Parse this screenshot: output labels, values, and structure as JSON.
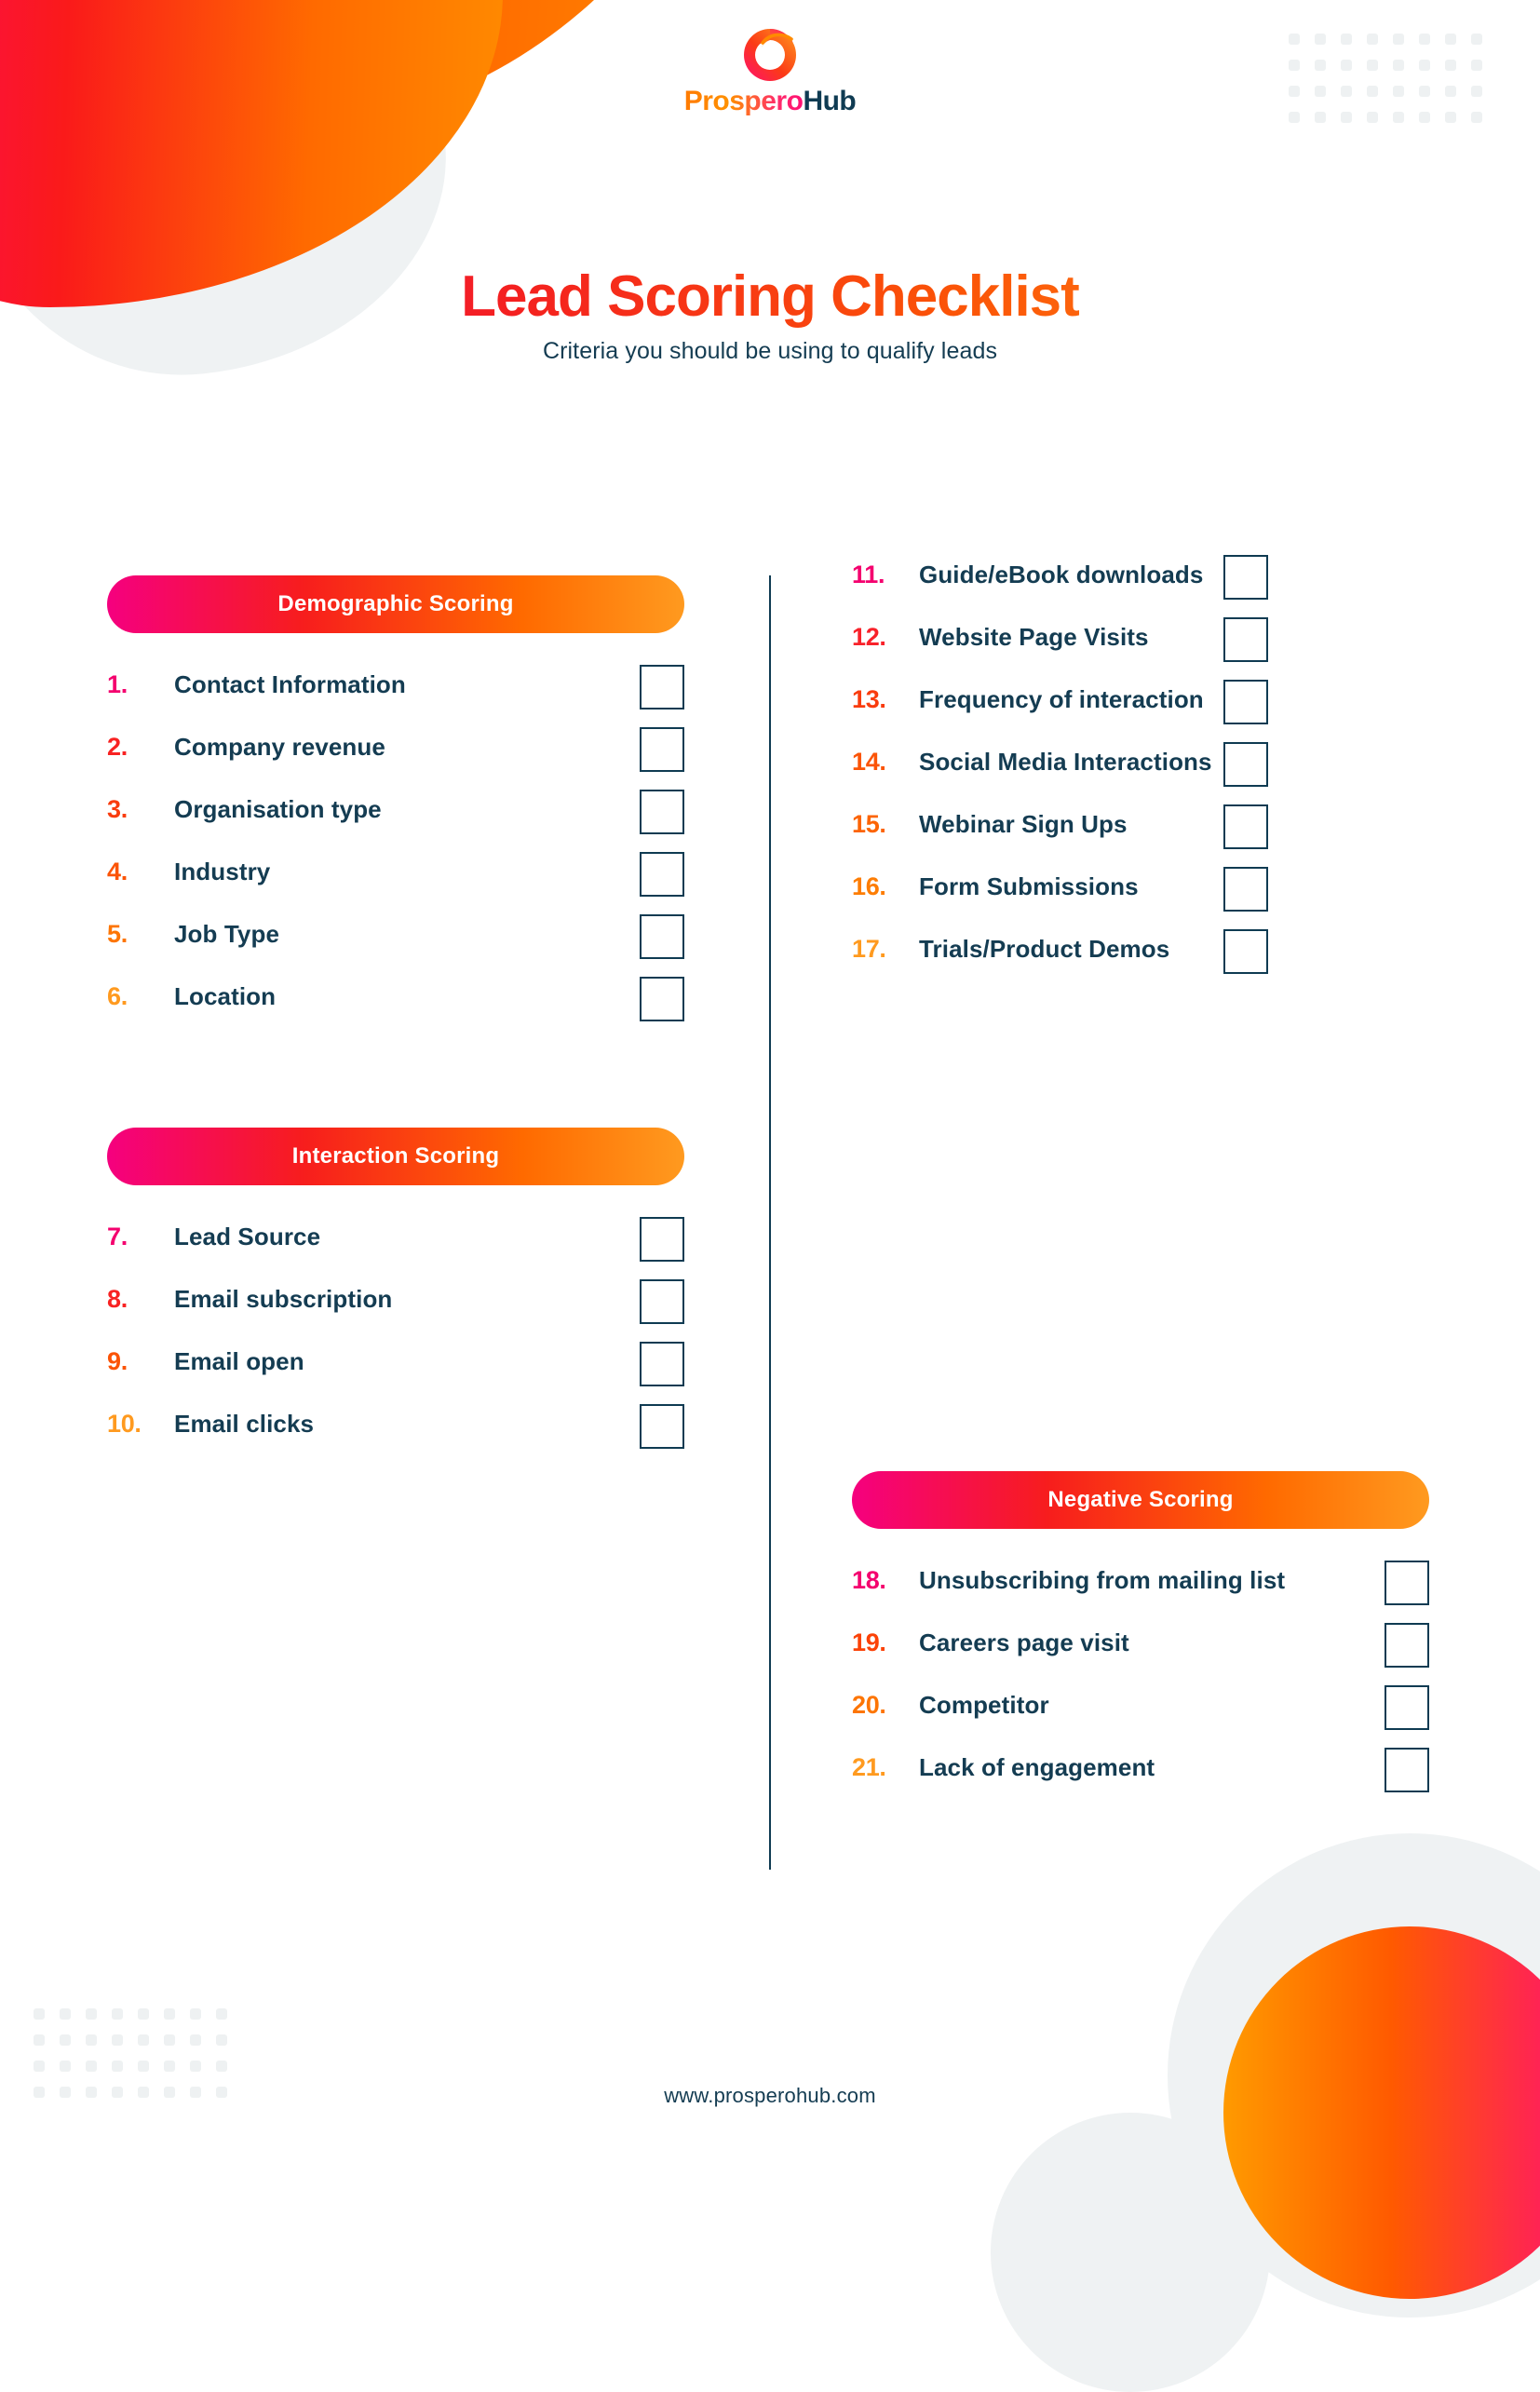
{
  "brand": {
    "logo_word_1": "Prospero",
    "logo_word_2": "Hub",
    "logo_icon": "swirl-circle-icon"
  },
  "header": {
    "title": "Lead Scoring Checklist",
    "subtitle": "Criteria you should be using to qualify leads"
  },
  "colors": {
    "pink": "#ed0f69",
    "red": "#f72020",
    "orange": "#ff6a00",
    "amber": "#ff9a1f",
    "navy": "#143c52",
    "gray_deco": "#eff2f3"
  },
  "sections": [
    {
      "id": "demographic-scoring",
      "heading": "Demographic Scoring",
      "column": "left",
      "items": [
        {
          "num": "1.",
          "label": "Contact Information",
          "color": "#f4006e",
          "checked": false
        },
        {
          "num": "2.",
          "label": "Company revenue",
          "color": "#f82222",
          "checked": false
        },
        {
          "num": "3.",
          "label": "Organisation type",
          "color": "#f93c0e",
          "checked": false
        },
        {
          "num": "4.",
          "label": "Industry",
          "color": "#fb5407",
          "checked": false
        },
        {
          "num": "5.",
          "label": "Job Type",
          "color": "#fd7504",
          "checked": false
        },
        {
          "num": "6.",
          "label": "Location",
          "color": "#ff9a1f",
          "checked": false
        }
      ]
    },
    {
      "id": "interaction-scoring",
      "heading": "Interaction Scoring",
      "column": "left",
      "items": [
        {
          "num": "7.",
          "label": "Lead Source",
          "color": "#f4006e",
          "checked": false
        },
        {
          "num": "8.",
          "label": "Email subscription",
          "color": "#f82222",
          "checked": false
        },
        {
          "num": "9.",
          "label": "Email open",
          "color": "#fb5407",
          "checked": false
        },
        {
          "num": "10.",
          "label": "Email clicks",
          "color": "#ff9a1f",
          "checked": false
        }
      ]
    },
    {
      "id": "positive-interaction-continued",
      "heading": "",
      "column": "right",
      "items": [
        {
          "num": "11.",
          "label": "Guide/eBook downloads",
          "color": "#f4006e",
          "checked": false
        },
        {
          "num": "12.",
          "label": "Website Page Visits",
          "color": "#f8222a",
          "checked": false
        },
        {
          "num": "13.",
          "label": "Frequency of interaction",
          "color": "#f93c0e",
          "checked": false
        },
        {
          "num": "14.",
          "label": "Social Media Interactions",
          "color": "#fb5407",
          "checked": false
        },
        {
          "num": "15.",
          "label": "Webinar Sign Ups",
          "color": "#fc6405",
          "checked": false
        },
        {
          "num": "16.",
          "label": "Form Submissions",
          "color": "#fd7d04",
          "checked": false
        },
        {
          "num": "17.",
          "label": "Trials/Product Demos",
          "color": "#ff9a1f",
          "checked": false
        }
      ]
    },
    {
      "id": "negative-scoring",
      "heading": "Negative Scoring",
      "column": "right",
      "items": [
        {
          "num": "18.",
          "label": "Unsubscribing from mailing list",
          "color": "#f4006e",
          "checked": false
        },
        {
          "num": "19.",
          "label": "Careers page visit",
          "color": "#fb4207",
          "checked": false
        },
        {
          "num": "20.",
          "label": "Competitor",
          "color": "#fd7504",
          "checked": false
        },
        {
          "num": "21.",
          "label": "Lack of engagement",
          "color": "#ff9a1f",
          "checked": false
        }
      ]
    }
  ],
  "footer": {
    "url": "www.prosperohub.com"
  }
}
